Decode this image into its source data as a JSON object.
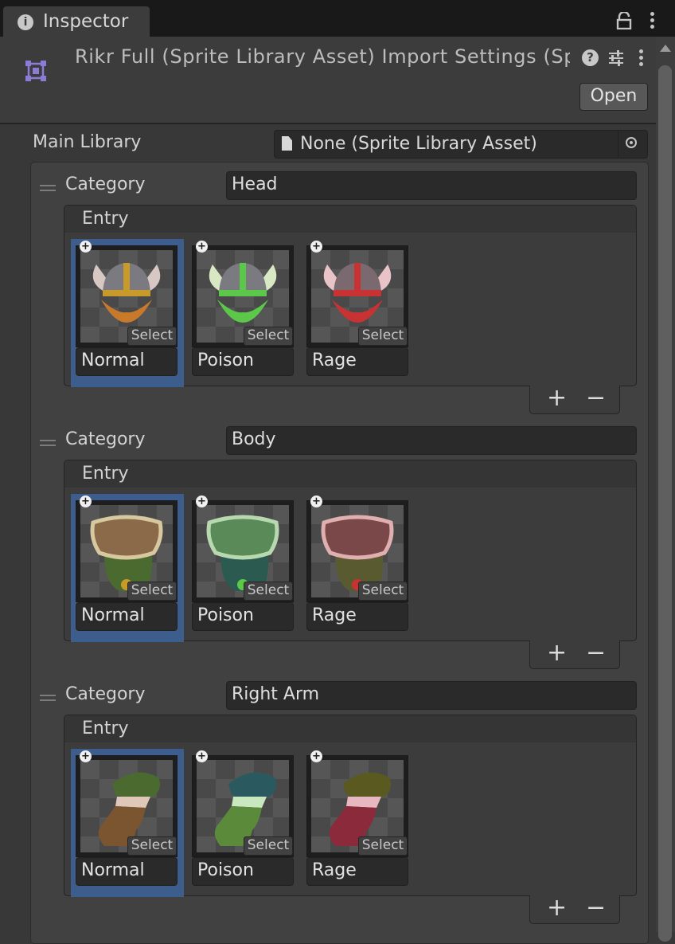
{
  "tab": {
    "title": "Inspector"
  },
  "header": {
    "title": "Rikr Full (Sprite Library Asset) Import Settings (Sp",
    "open_label": "Open"
  },
  "main_library": {
    "label": "Main Library",
    "value": "None (Sprite Library Asset)"
  },
  "categories": [
    {
      "label": "Category",
      "name": "Head",
      "entry_label": "Entry",
      "entries": [
        {
          "name": "Normal",
          "select_label": "Select",
          "color": "#c87a2a",
          "selected": true
        },
        {
          "name": "Poison",
          "select_label": "Select",
          "color": "#5bc84a",
          "selected": false
        },
        {
          "name": "Rage",
          "select_label": "Select",
          "color": "#c83232",
          "selected": false
        }
      ],
      "add_label": "+",
      "remove_label": "−"
    },
    {
      "label": "Category",
      "name": "Body",
      "entry_label": "Entry",
      "entries": [
        {
          "name": "Normal",
          "select_label": "Select",
          "color": "#8a6a48",
          "selected": true
        },
        {
          "name": "Poison",
          "select_label": "Select",
          "color": "#5a8a58",
          "selected": false
        },
        {
          "name": "Rage",
          "select_label": "Select",
          "color": "#7a4848",
          "selected": false
        }
      ],
      "add_label": "+",
      "remove_label": "−"
    },
    {
      "label": "Category",
      "name": "Right Arm",
      "entry_label": "Entry",
      "entries": [
        {
          "name": "Normal",
          "select_label": "Select",
          "color": "#7a5530",
          "selected": true
        },
        {
          "name": "Poison",
          "select_label": "Select",
          "color": "#5a8a3a",
          "selected": false
        },
        {
          "name": "Rage",
          "select_label": "Select",
          "color": "#8a2a3a",
          "selected": false
        }
      ],
      "add_label": "+",
      "remove_label": "−"
    }
  ],
  "icons": {
    "tab": "info-icon",
    "lock": "lock-icon",
    "menu": "kebab-menu-icon",
    "asset": "sprite-library-asset-icon",
    "help": "help-icon",
    "presets": "presets-icon",
    "object_picker": "object-picker-icon",
    "add_entry": "plus-circle-icon"
  }
}
